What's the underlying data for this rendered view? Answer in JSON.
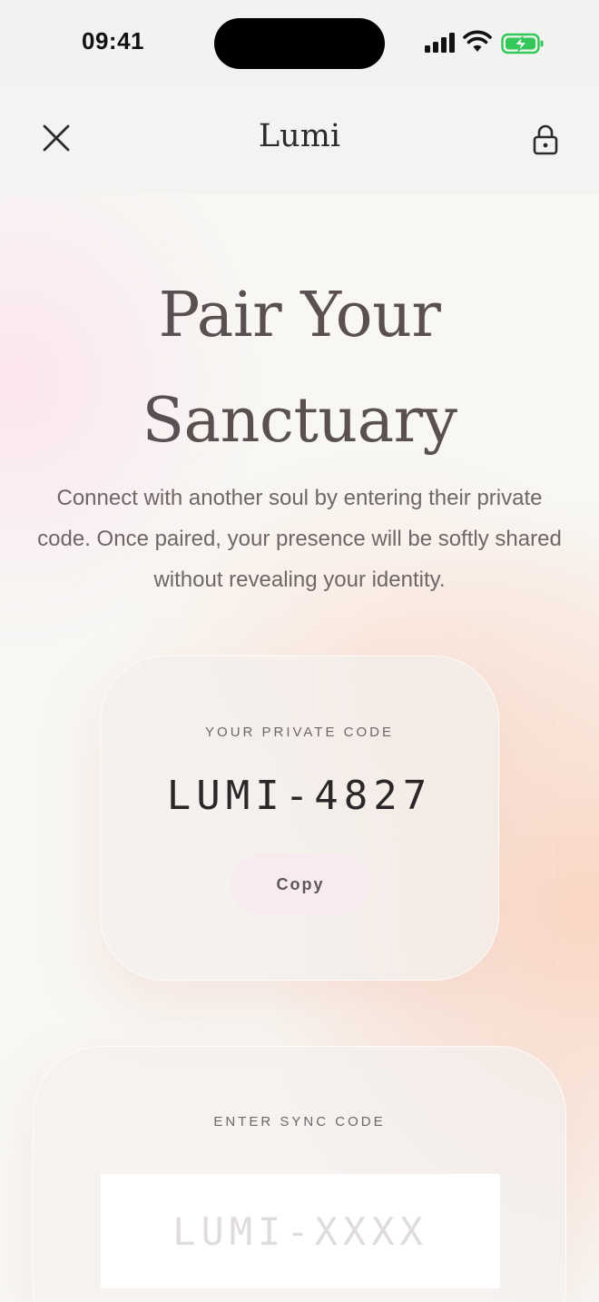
{
  "status_bar": {
    "time": "09:41",
    "signal_icon": "cellular-signal-icon",
    "wifi_icon": "wifi-icon",
    "battery_icon": "battery-charging-icon",
    "battery_color": "#34c759"
  },
  "header": {
    "close_icon": "close-icon",
    "title": "Lumi",
    "lock_icon": "lock-icon"
  },
  "hero": {
    "title_line1": "Pair Your",
    "title_line2": "Sanctuary",
    "description": "Connect with another soul by entering their private code. Once paired, your presence will be softly shared without revealing your identity."
  },
  "private_code_card": {
    "label": "YOUR PRIVATE CODE",
    "code": "LUMI-4827",
    "copy_label": "Copy"
  },
  "sync_card": {
    "label": "ENTER SYNC CODE",
    "input_placeholder": "LUMI-XXXX",
    "input_value": ""
  },
  "colors": {
    "accent_pink": "#f7ebef",
    "peach_glow": "#fad0bc",
    "title_text": "#5a5052"
  }
}
